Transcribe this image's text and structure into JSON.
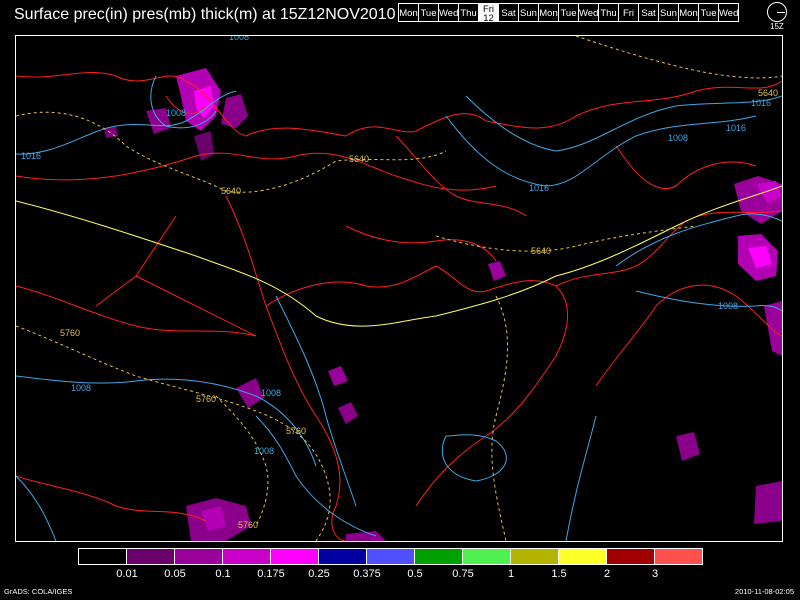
{
  "title": "Surface prec(in) pres(mb) thick(m) at 15Z12NOV2010",
  "days": [
    "Mon",
    "Tue",
    "Wed",
    "Thu",
    "Fri",
    "Sat",
    "Sun",
    "Mon",
    "Tue",
    "Wed",
    "Thu",
    "Fri",
    "Sat",
    "Sun",
    "Mon",
    "Tue",
    "Wed"
  ],
  "selected_day": {
    "label": "Fri",
    "date": "12"
  },
  "clock_label": "15Z",
  "legend": {
    "colors": [
      "#000000",
      "#6a006a",
      "#9a009a",
      "#c800c8",
      "#ff00ff",
      "#0000a0",
      "#5050ff",
      "#00a000",
      "#50f050",
      "#b4b400",
      "#ffff28",
      "#a00000",
      "#ff5050"
    ],
    "ticks": [
      "0.01",
      "0.05",
      "0.1",
      "0.175",
      "0.25",
      "0.375",
      "0.5",
      "0.75",
      "1",
      "1.5",
      "2",
      "3"
    ]
  },
  "isobars": [
    "1008",
    "1016",
    "1016",
    "1016",
    "1016",
    "1008",
    "1008",
    "1008",
    "1008",
    "1008"
  ],
  "thickness": [
    "5520",
    "5640",
    "5640",
    "5640",
    "5640",
    "5760",
    "5760",
    "5760",
    "5760"
  ],
  "colors": {
    "isobar": "#3fa7e6",
    "thickness_5640": "#e6c04a",
    "thickness_5700": "#ffff60",
    "border": "#ff2020"
  },
  "footer": {
    "left": "GrADS: COLA/IGES",
    "right": "2010-11-08-02:05"
  }
}
